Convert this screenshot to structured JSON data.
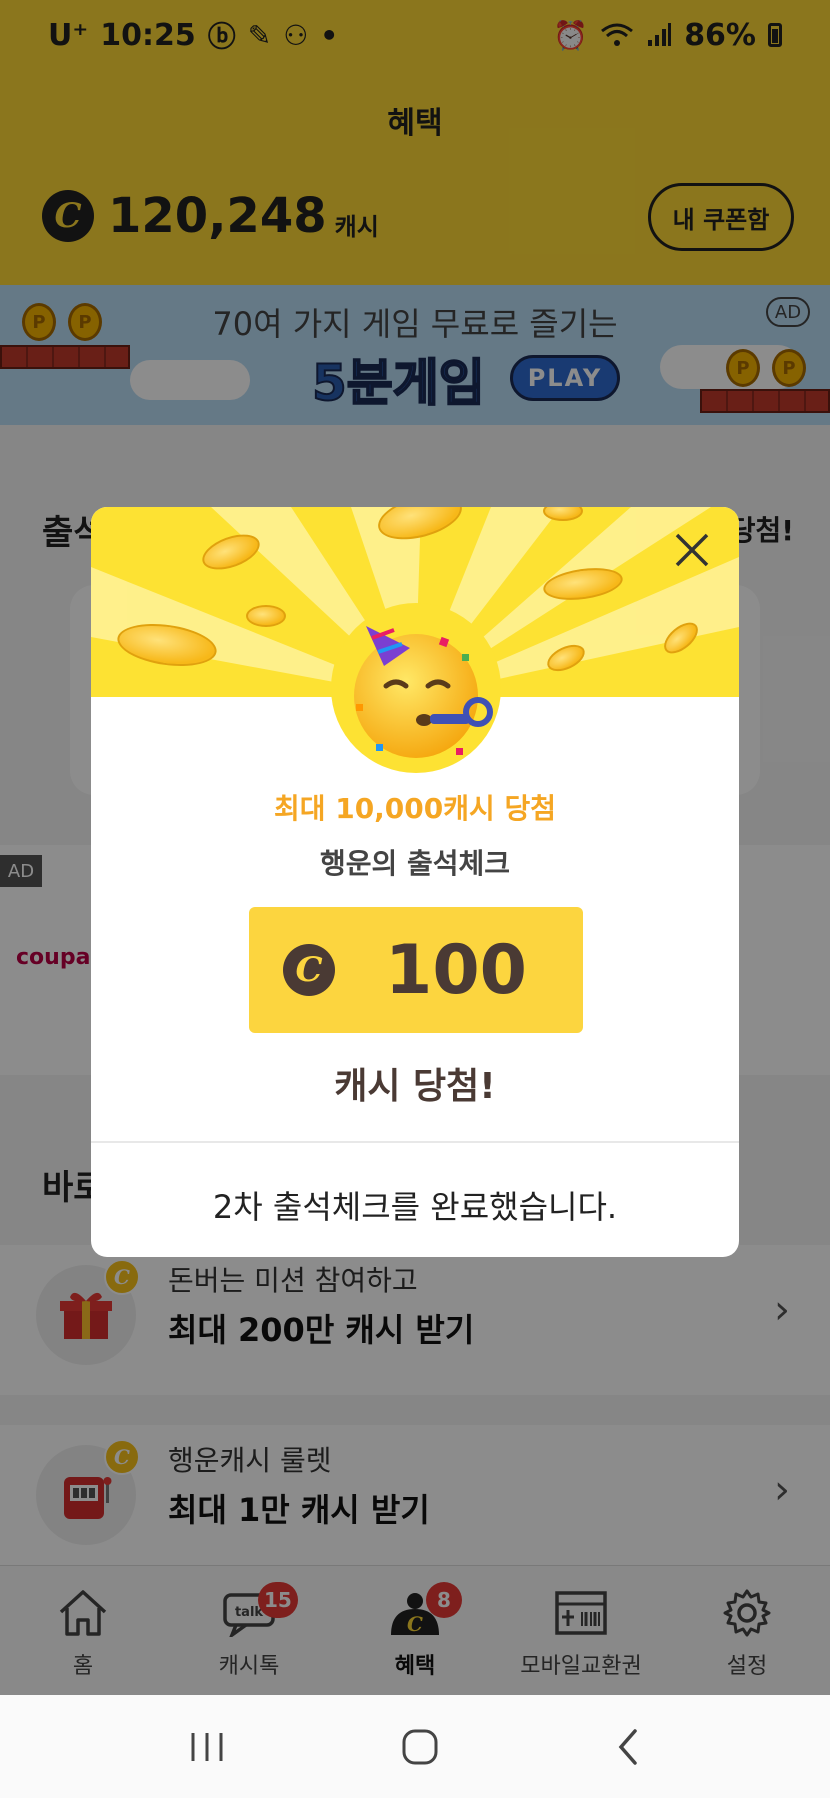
{
  "status_bar": {
    "carrier": "U⁺",
    "time": "10:25",
    "notification_icons": [
      "b-app-icon",
      "feather-icon",
      "dots-icon",
      "dot-icon"
    ],
    "battery": "86%"
  },
  "header": {
    "title": "혜택",
    "cash_amount": "120,248",
    "cash_unit": "캐시",
    "coupon_button": "내 쿠폰함"
  },
  "ad_banner": {
    "line1": "70여 가지 게임 무료로 즐기는",
    "game_title": "5분게임",
    "play_label": "PLAY",
    "ad_tag": "AD"
  },
  "background": {
    "attendance_title": "출석체",
    "attendance_prize_fragment": "당첨!",
    "ad_tag": "AD",
    "coupang_text": "coupang",
    "mission_head": "바로"
  },
  "missions": [
    {
      "sub": "돈버는 미션 참여하고",
      "main": "최대 200만 캐시 받기",
      "icon": "gift-icon"
    },
    {
      "sub": "행운캐시 룰렛",
      "main": "최대 1만 캐시 받기",
      "icon": "slot-machine-icon"
    }
  ],
  "bottom_nav": [
    {
      "label": "홈",
      "icon": "home-icon",
      "badge": ""
    },
    {
      "label": "캐시톡",
      "icon": "talk-icon",
      "badge": "15"
    },
    {
      "label": "혜택",
      "icon": "benefit-icon",
      "badge": "8",
      "active": true
    },
    {
      "label": "모바일교환권",
      "icon": "voucher-icon",
      "badge": ""
    },
    {
      "label": "설정",
      "icon": "gear-icon",
      "badge": ""
    }
  ],
  "dialog": {
    "prize_sub": "최대 10,000캐시 당첨",
    "prize_name": "행운의 출석체크",
    "amount": "100",
    "win_text": "캐시 당첨!",
    "completion": "2차 출석체크를 완료했습니다."
  },
  "colors": {
    "brand_yellow": "#fdd835",
    "prize_box": "#fcd53f",
    "accent_orange": "#f5a623",
    "brown_text": "#4a3a34",
    "badge_red": "#e53935"
  }
}
